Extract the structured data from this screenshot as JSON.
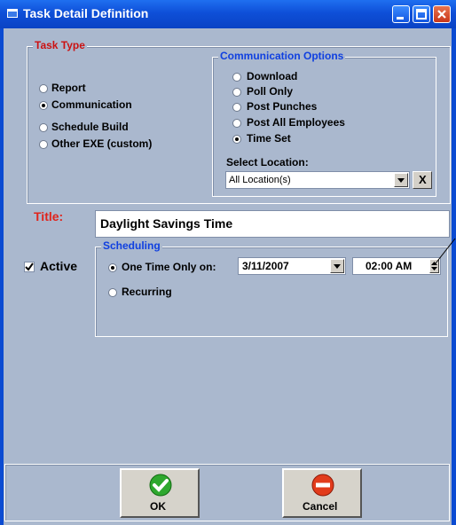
{
  "window": {
    "title": "Task Detail Definition"
  },
  "task_type": {
    "legend": "Task Type",
    "options": [
      {
        "label": "Report",
        "selected": false
      },
      {
        "label": "Communication",
        "selected": true
      },
      {
        "label": "Schedule Build",
        "selected": false
      },
      {
        "label": "Other EXE (custom)",
        "selected": false
      }
    ]
  },
  "communication_options": {
    "legend": "Communication Options",
    "options": [
      {
        "label": "Download",
        "selected": false
      },
      {
        "label": "Poll Only",
        "selected": false
      },
      {
        "label": "Post Punches",
        "selected": false
      },
      {
        "label": "Post All Employees",
        "selected": false
      },
      {
        "label": "Time Set",
        "selected": true
      }
    ],
    "select_location_label": "Select Location:",
    "location_value": "All Location(s)",
    "clear_label": "X"
  },
  "title_field": {
    "label": "Title:",
    "value": "Daylight Savings Time"
  },
  "active": {
    "label": "Active",
    "checked": true
  },
  "scheduling": {
    "legend": "Scheduling",
    "one_time_label": "One Time Only on:",
    "date_value": "3/11/2007",
    "time_value": "02:00 AM",
    "recurring_label": "Recurring"
  },
  "buttons": {
    "ok": "OK",
    "cancel": "Cancel"
  },
  "colors": {
    "title_red": "#e0241c",
    "legend_blue": "#1040e0",
    "task_type_red": "#cc1111",
    "window_bg": "#aab8ce"
  }
}
